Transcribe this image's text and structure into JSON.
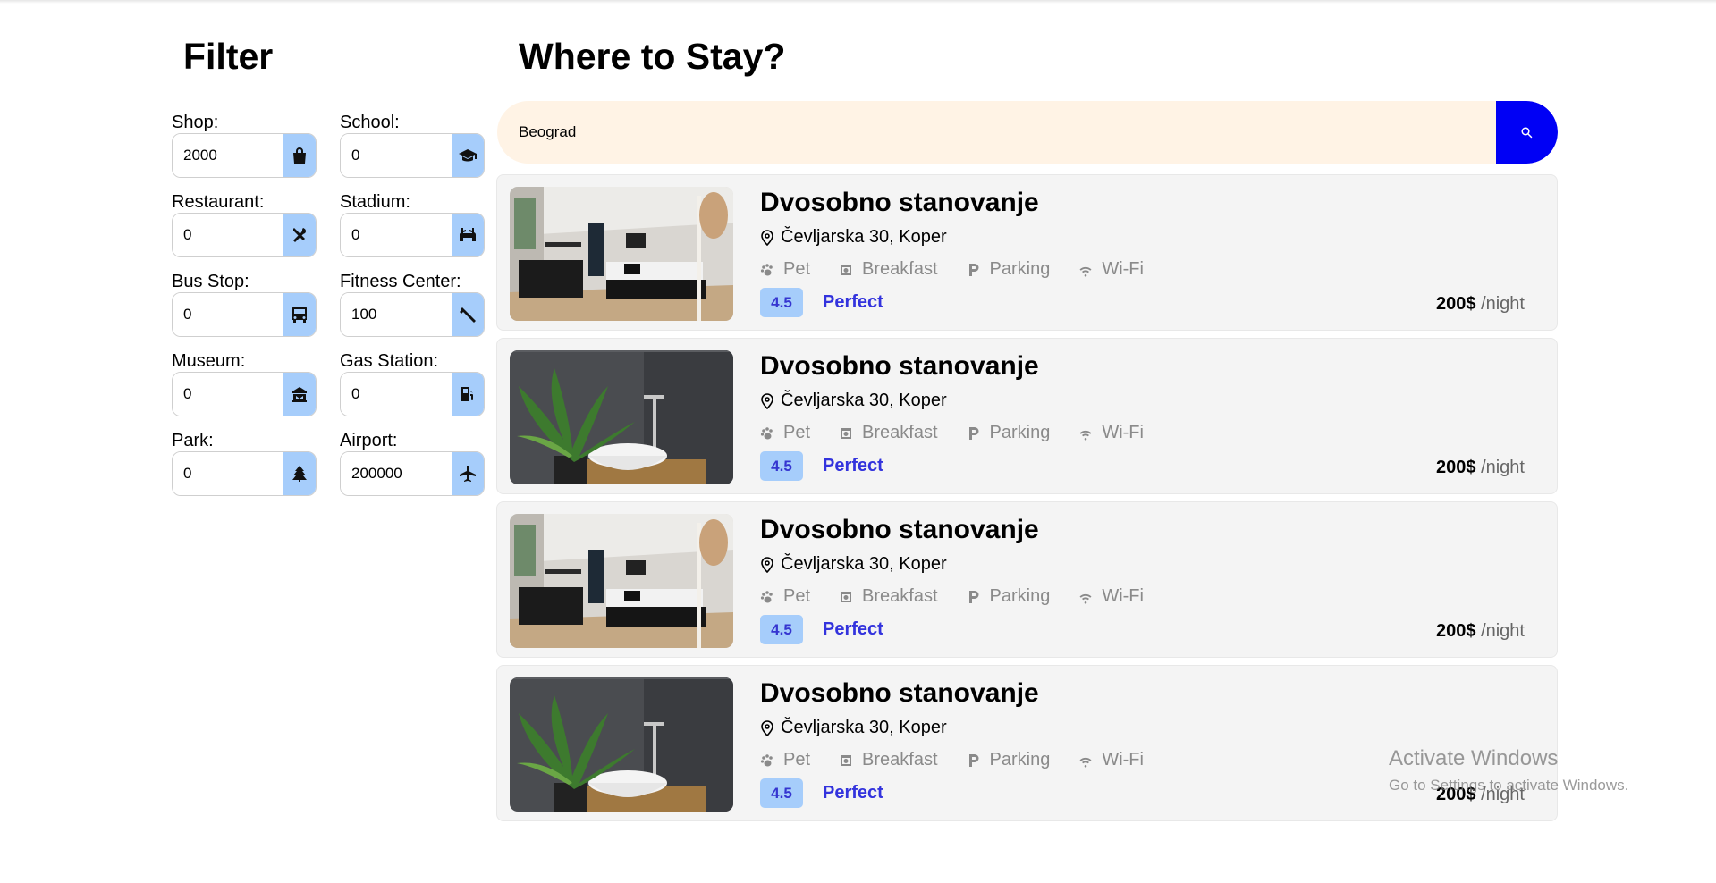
{
  "filter": {
    "title": "Filter",
    "fields": [
      {
        "label": "Shop:",
        "value": "2000",
        "icon": "shopping-bag-icon"
      },
      {
        "label": "School:",
        "value": "0",
        "icon": "graduation-cap-icon"
      },
      {
        "label": "Restaurant:",
        "value": "0",
        "icon": "utensils-icon"
      },
      {
        "label": "Stadium:",
        "value": "0",
        "icon": "stadium-icon"
      },
      {
        "label": "Bus Stop:",
        "value": "0",
        "icon": "bus-icon"
      },
      {
        "label": "Fitness Center:",
        "value": "100",
        "icon": "dumbbell-icon"
      },
      {
        "label": "Museum:",
        "value": "0",
        "icon": "museum-icon"
      },
      {
        "label": "Gas Station:",
        "value": "0",
        "icon": "gas-pump-icon"
      },
      {
        "label": "Park:",
        "value": "0",
        "icon": "tree-icon"
      },
      {
        "label": "Airport:",
        "value": "200000",
        "icon": "plane-icon"
      }
    ]
  },
  "main": {
    "title": "Where to Stay?",
    "search": {
      "value": "Beograd",
      "button_icon": "search-icon"
    }
  },
  "listings": [
    {
      "title": "Dvosobno stanovanje",
      "address": "Čevljarska 30, Koper",
      "amenities": [
        "Pet",
        "Breakfast",
        "Parking",
        "Wi-Fi"
      ],
      "rating": "4.5",
      "rating_text": "Perfect",
      "price": "200$",
      "price_unit": "/night",
      "image": "bedroom"
    },
    {
      "title": "Dvosobno stanovanje",
      "address": "Čevljarska 30, Koper",
      "amenities": [
        "Pet",
        "Breakfast",
        "Parking",
        "Wi-Fi"
      ],
      "rating": "4.5",
      "rating_text": "Perfect",
      "price": "200$",
      "price_unit": "/night",
      "image": "bathroom"
    },
    {
      "title": "Dvosobno stanovanje",
      "address": "Čevljarska 30, Koper",
      "amenities": [
        "Pet",
        "Breakfast",
        "Parking",
        "Wi-Fi"
      ],
      "rating": "4.5",
      "rating_text": "Perfect",
      "price": "200$",
      "price_unit": "/night",
      "image": "bedroom"
    },
    {
      "title": "Dvosobno stanovanje",
      "address": "Čevljarska 30, Koper",
      "amenities": [
        "Pet",
        "Breakfast",
        "Parking",
        "Wi-Fi"
      ],
      "rating": "4.5",
      "rating_text": "Perfect",
      "price": "200$",
      "price_unit": "/night",
      "image": "bathroom"
    }
  ],
  "watermark": {
    "line1": "Activate Windows",
    "line2": "Go to Settings to activate Windows."
  },
  "colors": {
    "accent": "#0000f5",
    "icon_button": "#a6cdfb",
    "search_bg": "#fff3e5",
    "rating_text": "#3333dd"
  }
}
